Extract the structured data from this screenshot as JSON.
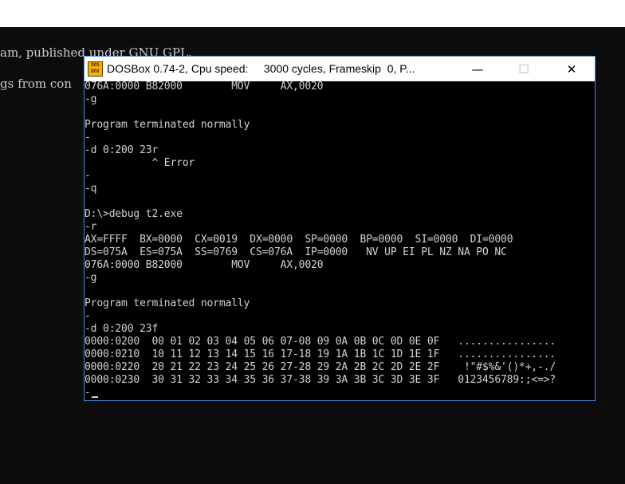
{
  "background_console": {
    "lines": [
      "am, published under GNU GPL.",
      "gs from con"
    ]
  },
  "window": {
    "app_icon_text": "DOS BOX",
    "title": "DOSBox 0.74-2, Cpu speed:     3000 cycles, Frameskip  0, P...",
    "controls": {
      "minimize": "—",
      "maximize": "☐",
      "close": "✕"
    }
  },
  "terminal": {
    "lines": [
      "076A:0000 B82000        MOV     AX,0020",
      "-g",
      "",
      "Program terminated normally",
      "-",
      "-d 0:200 23r",
      "           ^ Error",
      "-",
      "-q",
      "",
      "D:\\>debug t2.exe",
      "-r",
      "AX=FFFF  BX=0000  CX=0019  DX=0000  SP=0000  BP=0000  SI=0000  DI=0000",
      "DS=075A  ES=075A  SS=0769  CS=076A  IP=0000   NV UP EI PL NZ NA PO NC",
      "076A:0000 B82000        MOV     AX,0020",
      "-g",
      "",
      "Program terminated normally",
      "-",
      "-d 0:200 23f",
      "0000:0200  00 01 02 03 04 05 06 07-08 09 0A 0B 0C 0D 0E 0F   ................",
      "0000:0210  10 11 12 13 14 15 16 17-18 19 1A 1B 1C 1D 1E 1F   ................",
      "0000:0220  20 21 22 23 24 25 26 27-28 29 2A 2B 2C 2D 2E 2F    !\"#$%&'()*+,-./",
      "0000:0230  30 31 32 33 34 35 36 37-38 39 3A 3B 3C 3D 3E 3F   0123456789:;<=>?",
      "-"
    ]
  },
  "colors": {
    "window_border": "#4a8fd6",
    "terminal_text": "#d2d2d2",
    "background": "#0c0c0c"
  }
}
